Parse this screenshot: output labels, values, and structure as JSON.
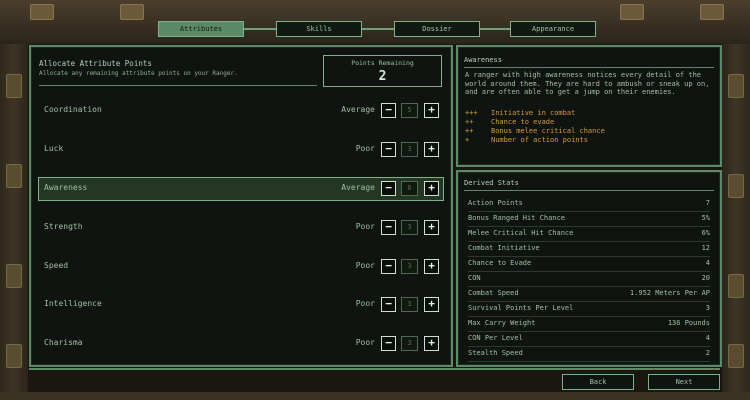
{
  "tabs": [
    {
      "label": "Attributes",
      "active": true
    },
    {
      "label": "Skills",
      "active": false
    },
    {
      "label": "Dossier",
      "active": false
    },
    {
      "label": "Appearance",
      "active": false
    }
  ],
  "allocate": {
    "title": "Allocate Attribute Points",
    "subtitle": "Allocate any remaining attribute points on your Ranger.",
    "points_label": "Points Remaining",
    "points_value": "2"
  },
  "attributes": [
    {
      "name": "Coordination",
      "rating": "Average",
      "value": "5",
      "minus": "−",
      "plus": "+"
    },
    {
      "name": "Luck",
      "rating": "Poor",
      "value": "3",
      "minus": "−",
      "plus": "+"
    },
    {
      "name": "Awareness",
      "rating": "Average",
      "value": "6",
      "minus": "−",
      "plus": "+"
    },
    {
      "name": "Strength",
      "rating": "Poor",
      "value": "3",
      "minus": "−",
      "plus": "+"
    },
    {
      "name": "Speed",
      "rating": "Poor",
      "value": "3",
      "minus": "−",
      "plus": "+"
    },
    {
      "name": "Intelligence",
      "rating": "Poor",
      "value": "3",
      "minus": "−",
      "plus": "+"
    },
    {
      "name": "Charisma",
      "rating": "Poor",
      "value": "3",
      "minus": "−",
      "plus": "+"
    }
  ],
  "selected_attribute": "Awareness",
  "description": {
    "title": "Awareness",
    "text": "A ranger with high awareness notices every detail of the world around them. They are hard to ambush or sneak up on, and are often able to get a jump on their enemies.",
    "effects": [
      {
        "marks": "+++",
        "label": "Initiative in combat"
      },
      {
        "marks": "++",
        "label": "Chance to evade"
      },
      {
        "marks": "++",
        "label": "Bonus melee critical chance"
      },
      {
        "marks": "+",
        "label": "Number of action points"
      }
    ]
  },
  "derived": {
    "title": "Derived Stats",
    "stats": [
      {
        "name": "Action Points",
        "value": "7"
      },
      {
        "name": "Bonus Ranged Hit Chance",
        "value": "5%"
      },
      {
        "name": "Melee Critical Hit Chance",
        "value": "6%"
      },
      {
        "name": "Combat Initiative",
        "value": "12"
      },
      {
        "name": "Chance to Evade",
        "value": "4"
      },
      {
        "name": "CON",
        "value": "20"
      },
      {
        "name": "Combat Speed",
        "value": "1.952 Meters Per AP"
      },
      {
        "name": "Survival Points Per Level",
        "value": "3"
      },
      {
        "name": "Max Carry Weight",
        "value": "136 Pounds"
      },
      {
        "name": "CON Per Level",
        "value": "4"
      },
      {
        "name": "Stealth Speed",
        "value": "2"
      }
    ]
  },
  "footer": {
    "back_label": "Back",
    "next_label": "Next"
  },
  "colors": {
    "accent": "#5d8a66",
    "panel_bg": "#0f1410",
    "effect_text": "#d99a3a"
  }
}
